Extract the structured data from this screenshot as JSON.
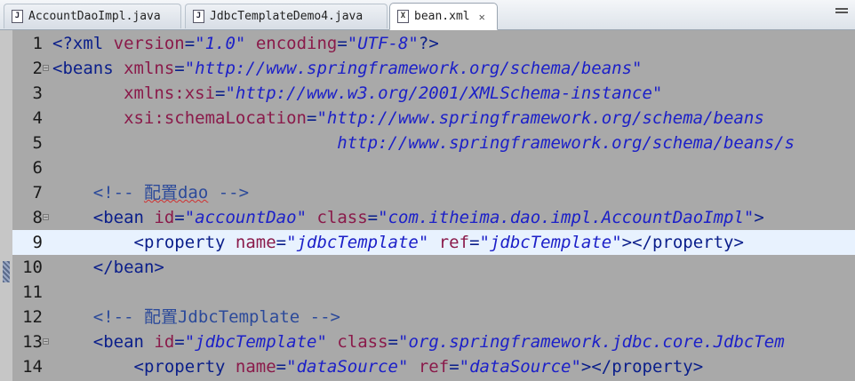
{
  "tabs": [
    {
      "label": "AccountDaoImpl.java",
      "icon": "J",
      "active": false
    },
    {
      "label": "JdbcTemplateDemo4.java",
      "icon": "J",
      "active": false
    },
    {
      "label": "bean.xml",
      "icon": "X",
      "active": true
    }
  ],
  "lines": [
    {
      "n": "1",
      "seg": [
        [
          "pi",
          "<?xml "
        ],
        [
          "a",
          "version"
        ],
        [
          "t",
          "="
        ],
        [
          "v",
          "\"1.0\""
        ],
        [
          "t",
          " "
        ],
        [
          "a",
          "encoding"
        ],
        [
          "t",
          "="
        ],
        [
          "v",
          "\"UTF-8\""
        ],
        [
          "pi",
          "?>"
        ]
      ]
    },
    {
      "n": "2",
      "fold": true,
      "seg": [
        [
          "t",
          "<beans "
        ],
        [
          "a",
          "xmlns"
        ],
        [
          "t",
          "="
        ],
        [
          "v",
          "\"http://www.springframework.org/schema/beans\""
        ]
      ]
    },
    {
      "n": "3",
      "seg": [
        [
          "t",
          "       "
        ],
        [
          "a",
          "xmlns:xsi"
        ],
        [
          "t",
          "="
        ],
        [
          "v",
          "\"http://www.w3.org/2001/XMLSchema-instance\""
        ]
      ]
    },
    {
      "n": "4",
      "seg": [
        [
          "t",
          "       "
        ],
        [
          "a",
          "xsi:schemaLocation"
        ],
        [
          "t",
          "="
        ],
        [
          "v",
          "\"http://www.springframework.org/schema/beans"
        ]
      ]
    },
    {
      "n": "5",
      "seg": [
        [
          "v",
          "                            http://www.springframework.org/schema/beans/s"
        ]
      ]
    },
    {
      "n": "6",
      "seg": []
    },
    {
      "n": "7",
      "seg": [
        [
          "c",
          "    <!-- "
        ],
        [
          "csq",
          "配置dao"
        ],
        [
          "c",
          " -->"
        ]
      ]
    },
    {
      "n": "8",
      "fold": true,
      "seg": [
        [
          "t",
          "    <bean "
        ],
        [
          "a",
          "id"
        ],
        [
          "t",
          "="
        ],
        [
          "v",
          "\"accountDao\""
        ],
        [
          "t",
          " "
        ],
        [
          "a",
          "class"
        ],
        [
          "t",
          "="
        ],
        [
          "v",
          "\"com.itheima.dao.impl.AccountDaoImpl\""
        ],
        [
          "t",
          ">"
        ]
      ]
    },
    {
      "n": "9",
      "hl": true,
      "seg": [
        [
          "t",
          "        <property "
        ],
        [
          "a",
          "name"
        ],
        [
          "t",
          "="
        ],
        [
          "v",
          "\"jdbcTemplate\""
        ],
        [
          "t",
          " "
        ],
        [
          "a",
          "ref"
        ],
        [
          "t",
          "="
        ],
        [
          "v",
          "\"jdbcTemplate\""
        ],
        [
          "t",
          "></property>"
        ]
      ]
    },
    {
      "n": "10",
      "seg": [
        [
          "t",
          "    </bean>"
        ]
      ]
    },
    {
      "n": "11",
      "seg": []
    },
    {
      "n": "12",
      "seg": [
        [
          "c",
          "    <!-- 配置JdbcTemplate -->"
        ]
      ]
    },
    {
      "n": "13",
      "fold": true,
      "seg": [
        [
          "t",
          "    <bean "
        ],
        [
          "a",
          "id"
        ],
        [
          "t",
          "="
        ],
        [
          "v",
          "\"jdbcTemplate\""
        ],
        [
          "t",
          " "
        ],
        [
          "a",
          "class"
        ],
        [
          "t",
          "="
        ],
        [
          "v",
          "\"org.springframework.jdbc.core.JdbcTem"
        ]
      ]
    },
    {
      "n": "14",
      "seg": [
        [
          "t",
          "        <property "
        ],
        [
          "a",
          "name"
        ],
        [
          "t",
          "="
        ],
        [
          "v",
          "\"dataSource\""
        ],
        [
          "t",
          " "
        ],
        [
          "a",
          "ref"
        ],
        [
          "t",
          "="
        ],
        [
          "v",
          "\"dataSource\""
        ],
        [
          "t",
          "></property>"
        ]
      ]
    }
  ]
}
